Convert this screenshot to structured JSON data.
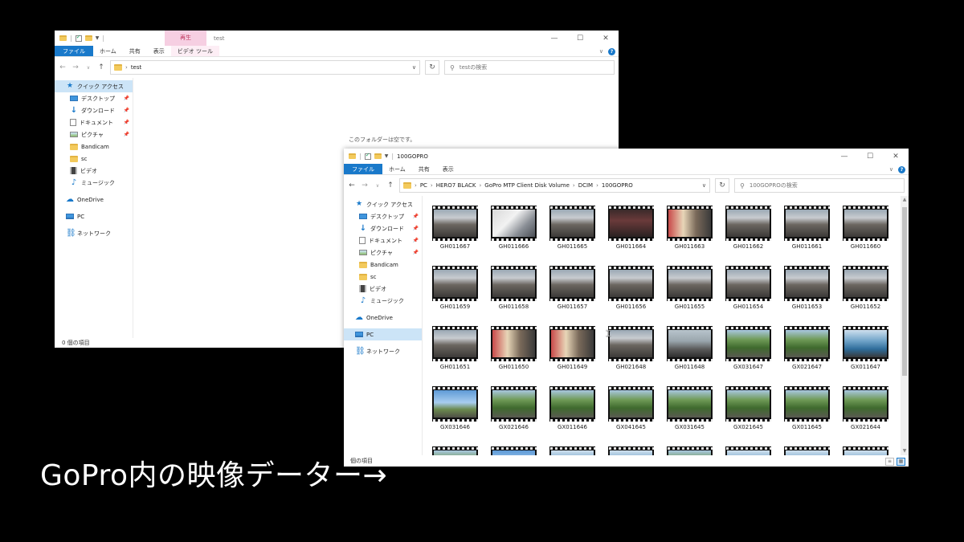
{
  "window_test": {
    "title": "test",
    "context_tab": "再生",
    "ribbon_tabs": [
      "ファイル",
      "ホーム",
      "共有",
      "表示",
      "ビデオ ツール"
    ],
    "address_path": [
      "test"
    ],
    "search_placeholder": "testの検索",
    "empty_message": "このフォルダーは空です。",
    "status": "0 個の項目"
  },
  "window_gopro": {
    "title": "100GOPRO",
    "ribbon_tabs": [
      "ファイル",
      "ホーム",
      "共有",
      "表示"
    ],
    "address_path": [
      "PC",
      "HERO7 BLACK",
      "GoPro MTP Client Disk Volume",
      "DCIM",
      "100GOPRO"
    ],
    "search_placeholder": "100GOPROの検索",
    "status": "個の項目",
    "files": [
      {
        "name": "GH011667",
        "scene": "street"
      },
      {
        "name": "GH011666",
        "scene": "closeup"
      },
      {
        "name": "GH011665",
        "scene": "street"
      },
      {
        "name": "GH011664",
        "scene": "dark"
      },
      {
        "name": "GH011663",
        "scene": "shop"
      },
      {
        "name": "GH011662",
        "scene": "street"
      },
      {
        "name": "GH011661",
        "scene": "street"
      },
      {
        "name": "GH011660",
        "scene": "street"
      },
      {
        "name": "GH011659",
        "scene": "street"
      },
      {
        "name": "GH011658",
        "scene": "street"
      },
      {
        "name": "GH011657",
        "scene": "street"
      },
      {
        "name": "GH011656",
        "scene": "street"
      },
      {
        "name": "GH011655",
        "scene": "street"
      },
      {
        "name": "GH011654",
        "scene": "street"
      },
      {
        "name": "GH011653",
        "scene": "street"
      },
      {
        "name": "GH011652",
        "scene": "street"
      },
      {
        "name": "GH011651",
        "scene": "street"
      },
      {
        "name": "GH011650",
        "scene": "shop"
      },
      {
        "name": "GH011649",
        "scene": "shop"
      },
      {
        "name": "GH021648",
        "scene": "street"
      },
      {
        "name": "GH011648",
        "scene": "road"
      },
      {
        "name": "GX031647",
        "scene": "forest"
      },
      {
        "name": "GX021647",
        "scene": "forest"
      },
      {
        "name": "GX011647",
        "scene": "bluecar"
      },
      {
        "name": "GX031646",
        "scene": "sky"
      },
      {
        "name": "GX021646",
        "scene": "forest"
      },
      {
        "name": "GX011646",
        "scene": "forest"
      },
      {
        "name": "GX041645",
        "scene": "forest"
      },
      {
        "name": "GX031645",
        "scene": "forest"
      },
      {
        "name": "GX021645",
        "scene": "forest"
      },
      {
        "name": "GX011645",
        "scene": "forest"
      },
      {
        "name": "GX021644",
        "scene": "forest"
      },
      {
        "name": "",
        "scene": "forest"
      },
      {
        "name": "",
        "scene": "sky"
      },
      {
        "name": "",
        "scene": "bluecar"
      },
      {
        "name": "",
        "scene": "bluecar"
      },
      {
        "name": "",
        "scene": "forest"
      },
      {
        "name": "",
        "scene": "bluecar"
      },
      {
        "name": "",
        "scene": "bluecar"
      },
      {
        "name": "",
        "scene": "bluecar"
      }
    ]
  },
  "sidebar": {
    "quick_access": "クイック アクセス",
    "items": [
      "デスクトップ",
      "ダウンロード",
      "ドキュメント",
      "ピクチャ",
      "Bandicam",
      "sc",
      "ビデオ",
      "ミュージック"
    ],
    "onedrive": "OneDrive",
    "pc": "PC",
    "network": "ネットワーク"
  },
  "caption": "GoPro内の映像データー→",
  "colors": {
    "accent": "#1979ca",
    "selection": "#cce4f7",
    "context_tab": "#f6cfe2",
    "background": "#000000"
  }
}
